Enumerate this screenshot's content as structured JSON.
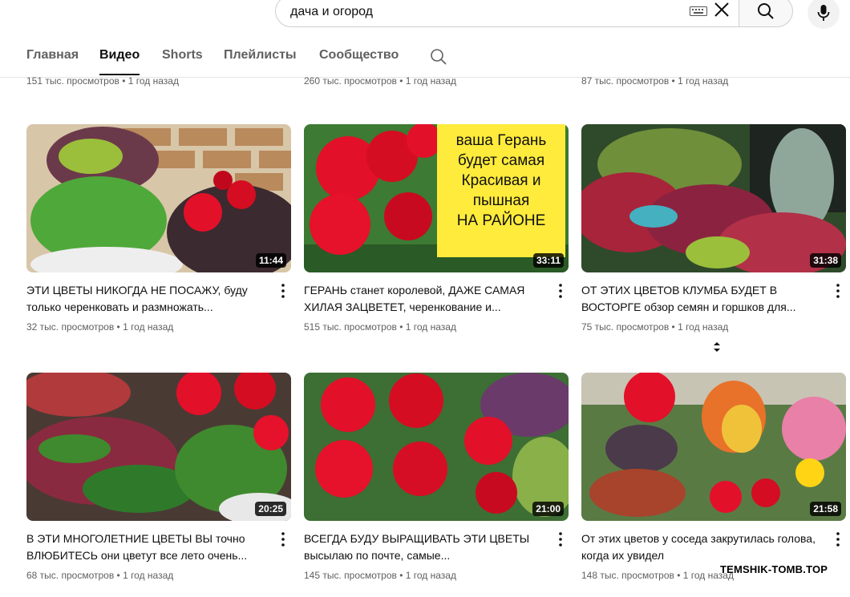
{
  "search": {
    "query": "дача и огород"
  },
  "tabs": [
    "Главная",
    "Видео",
    "Shorts",
    "Плейлисты",
    "Сообщество"
  ],
  "active_tab": "Видео",
  "prev_row": [
    {
      "meta": "151 тыс. просмотров • 1 год назад"
    },
    {
      "meta": "260 тыс. просмотров • 1 год назад"
    },
    {
      "meta": "87 тыс. просмотров • 1 год назад"
    }
  ],
  "videos": [
    {
      "title": "ЭТИ ЦВЕТЫ НИКОГДА НЕ ПОСАЖУ, буду только черенковать и размножать...",
      "meta": "32 тыс. просмотров • 1 год назад",
      "duration": "11:44"
    },
    {
      "title": "ГЕРАНЬ станет королевой, ДАЖЕ САМАЯ ХИЛАЯ ЗАЦВЕТЕТ, черенкование и...",
      "meta": "515 тыс. просмотров • 1 год назад",
      "duration": "33:11",
      "overlay": "ваша Герань\nбудет самая\nКрасивая и\nпышная\nНА РАЙОНЕ"
    },
    {
      "title": "ОТ ЭТИХ ЦВЕТОВ КЛУМБА БУДЕТ В ВОСТОРГЕ обзор семян и горшков для...",
      "meta": "75 тыс. просмотров • 1 год назад",
      "duration": "31:38"
    },
    {
      "title": "В ЭТИ МНОГОЛЕТНИЕ ЦВЕТЫ ВЫ точно ВЛЮБИТЕСЬ они цветут все лето очень...",
      "meta": "68 тыс. просмотров • 1 год назад",
      "duration": "20:25"
    },
    {
      "title": "ВСЕГДА БУДУ ВЫРАЩИВАТЬ ЭТИ ЦВЕТЫ высылаю по почте, самые...",
      "meta": "145 тыс. просмотров • 1 год назад",
      "duration": "21:00"
    },
    {
      "title": "От этих цветов у соседа закрутилась голова, когда их увидел",
      "meta": "148 тыс. просмотров • 1 год назад",
      "duration": "21:58"
    }
  ],
  "watermark": "TEMSHIK-TOMB.TOP",
  "colors": {
    "accent_red": "#e3102a",
    "leaf_green": "#3f8a2e",
    "overlay_yellow": "#ffeb3b"
  }
}
